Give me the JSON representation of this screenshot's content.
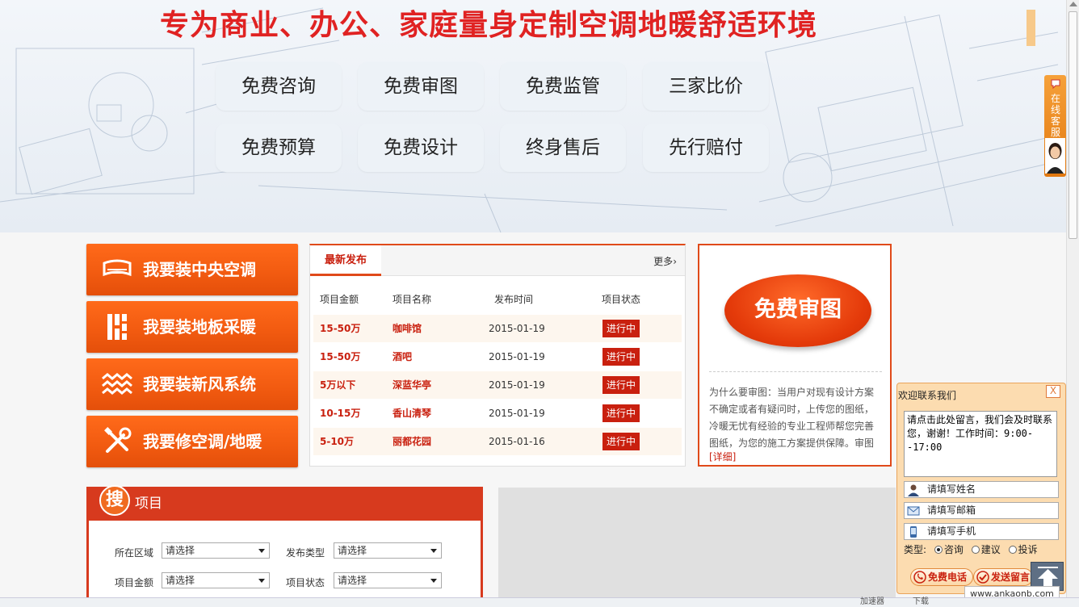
{
  "banner": {
    "title": "专为商业、办公、家庭量身定制空调地暖舒适环境",
    "features": [
      "免费咨询",
      "免费审图",
      "免费监管",
      "三家比价",
      "免费预算",
      "免费设计",
      "终身售后",
      "先行赔付"
    ]
  },
  "services": [
    {
      "label": "我要装中央空调",
      "icon": "air-conditioner-icon"
    },
    {
      "label": "我要装地板采暖",
      "icon": "floor-heating-icon"
    },
    {
      "label": "我要装新风系统",
      "icon": "fresh-air-icon"
    },
    {
      "label": "我要修空调/地暖",
      "icon": "repair-tools-icon"
    }
  ],
  "latest": {
    "tab": "最新发布",
    "more": "更多",
    "columns": [
      "项目金额",
      "项目名称",
      "发布时间",
      "项目状态"
    ],
    "rows": [
      {
        "amount": "15-50万",
        "name": "咖啡馆",
        "date": "2015-01-19",
        "status": "进行中"
      },
      {
        "amount": "15-50万",
        "name": "酒吧",
        "date": "2015-01-19",
        "status": "进行中"
      },
      {
        "amount": "5万以下",
        "name": "深蓝华亭",
        "date": "2015-01-19",
        "status": "进行中"
      },
      {
        "amount": "10-15万",
        "name": "香山清琴",
        "date": "2015-01-19",
        "status": "进行中"
      },
      {
        "amount": "5-10万",
        "name": "丽都花园",
        "date": "2015-01-16",
        "status": "进行中"
      }
    ]
  },
  "review": {
    "button": "免费审图",
    "description": "为什么要审图：当用户对现有设计方案不确定或者有疑问时，上传您的图纸，冷暖无忧有经验的专业工程师帮您完善图纸，为您的施工方案提供保障。审图",
    "more": "[详细]"
  },
  "search": {
    "badge": "搜",
    "title": "项目",
    "fields": [
      {
        "label": "所在区域",
        "value": "请选择"
      },
      {
        "label": "发布类型",
        "value": "请选择"
      },
      {
        "label": "项目金额",
        "value": "请选择"
      },
      {
        "label": "项目状态",
        "value": "请选择"
      }
    ]
  },
  "side_tab": {
    "text": "在线客服"
  },
  "chat": {
    "title": "欢迎联系我们",
    "close": "X",
    "message": "请点击此处留言，我们会及时联系您，谢谢！工作时间：9:00--17:00",
    "name_placeholder": "请填写姓名",
    "email_placeholder": "请填写邮箱",
    "phone_placeholder": "请填写手机",
    "type_label": "类型:",
    "types": [
      "咨询",
      "建议",
      "投诉"
    ],
    "selected_type": "咨询",
    "call_button": "免费电话",
    "send_button": "发送留言"
  },
  "url": "www.ankaonb.com",
  "statusbar": {
    "left": "加速器",
    "right": "下载"
  },
  "colors": {
    "accent": "#e04a1a",
    "brand_red": "#c9200f",
    "orange": "#f15a10",
    "title_red": "#e02222"
  }
}
